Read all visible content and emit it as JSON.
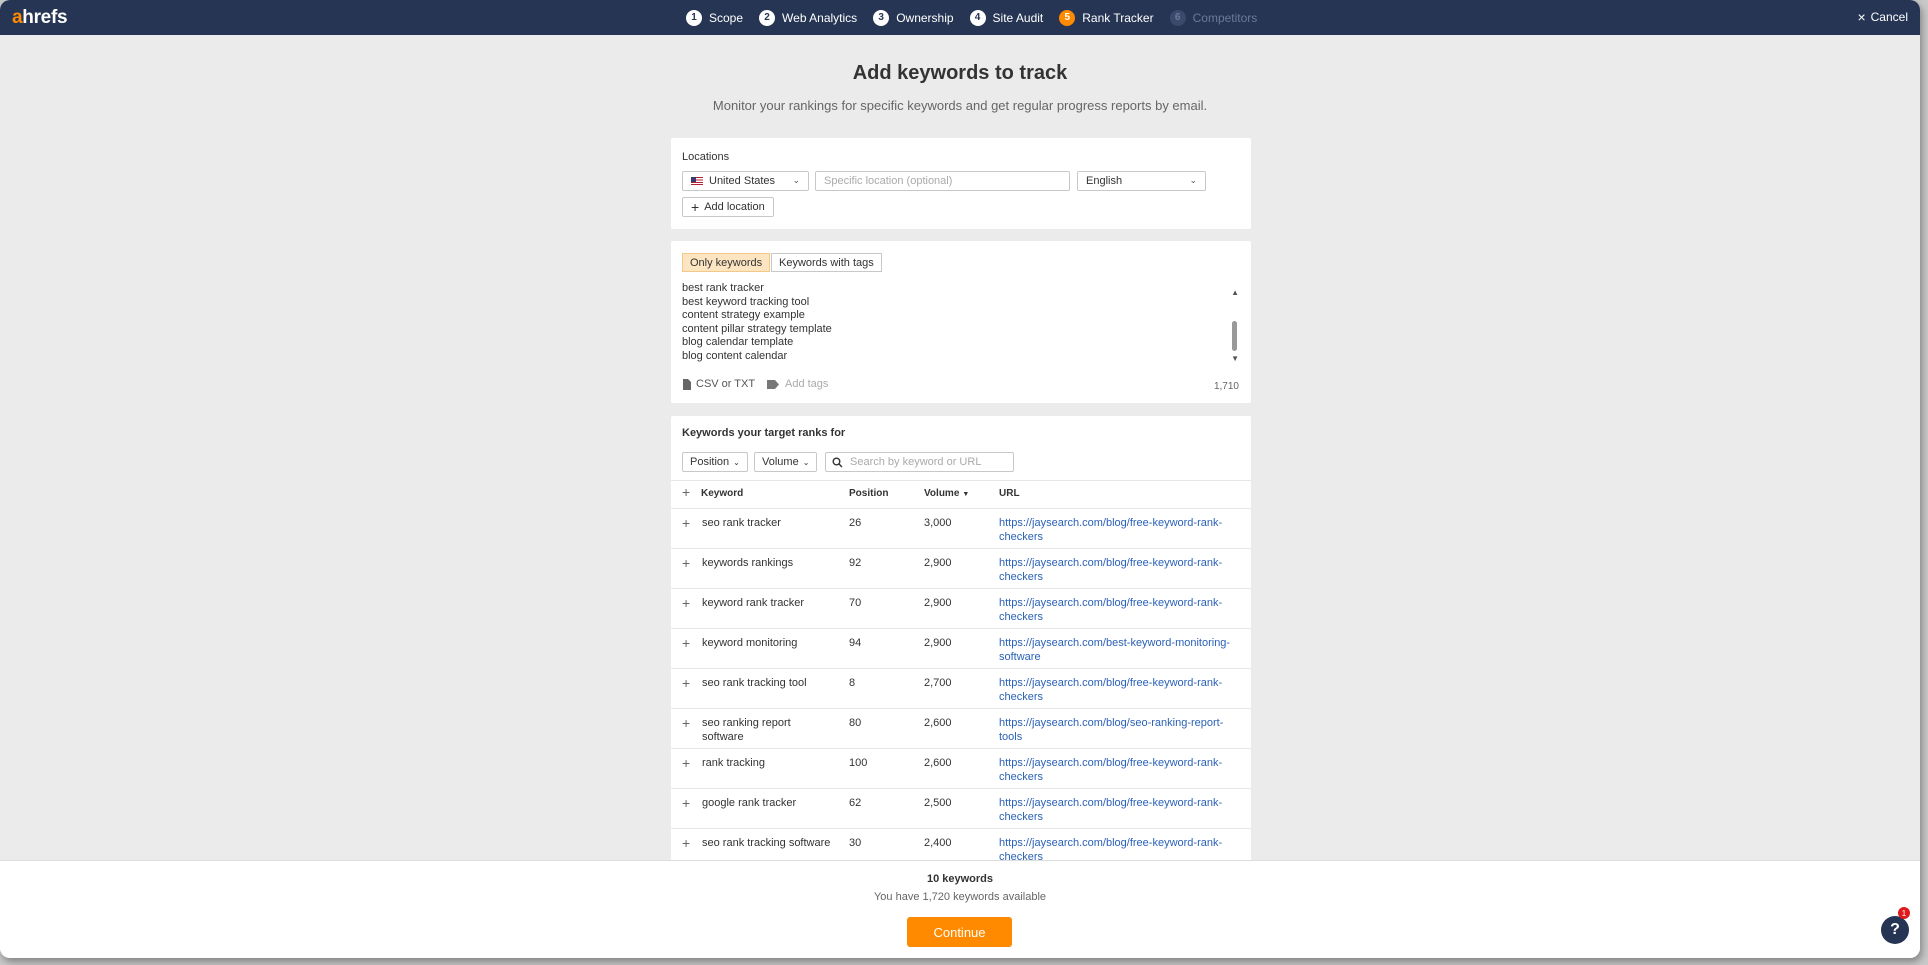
{
  "brand": {
    "logo_a": "a",
    "logo_rest": "hrefs",
    "accent": "#ff8a00",
    "nav_bg": "#263554"
  },
  "steps": [
    {
      "num": "1",
      "label": "Scope"
    },
    {
      "num": "2",
      "label": "Web Analytics"
    },
    {
      "num": "3",
      "label": "Ownership"
    },
    {
      "num": "4",
      "label": "Site Audit"
    },
    {
      "num": "5",
      "label": "Rank Tracker"
    },
    {
      "num": "6",
      "label": "Competitors"
    }
  ],
  "cancel_label": "Cancel",
  "page": {
    "title": "Add keywords to track",
    "subtitle": "Monitor your rankings for specific keywords and get regular progress reports by email."
  },
  "locations": {
    "label": "Locations",
    "country": "United States",
    "specific_placeholder": "Specific location (optional)",
    "language": "English",
    "add_location": "Add location"
  },
  "keywords_input": {
    "tabs": [
      "Only keywords",
      "Keywords with tags"
    ],
    "lines": [
      "best rank tracker",
      "best keyword tracking tool",
      "content strategy example",
      "content pillar strategy template",
      "blog calendar template",
      "blog content calendar"
    ],
    "csv_label": "CSV or TXT",
    "add_tags_label": "Add tags",
    "count": "1,710"
  },
  "target": {
    "title": "Keywords your target ranks for",
    "filters": [
      "Position",
      "Volume"
    ],
    "search_placeholder": "Search by keyword or URL",
    "headers": {
      "keyword": "Keyword",
      "position": "Position",
      "volume": "Volume",
      "url": "URL"
    },
    "rows": [
      {
        "keyword": "seo rank tracker",
        "position": "26",
        "volume": "3,000",
        "url": "https://jaysearch.com/blog/free-keyword-rank-checkers"
      },
      {
        "keyword": "keywords rankings",
        "position": "92",
        "volume": "2,900",
        "url": "https://jaysearch.com/blog/free-keyword-rank-checkers"
      },
      {
        "keyword": "keyword rank tracker",
        "position": "70",
        "volume": "2,900",
        "url": "https://jaysearch.com/blog/free-keyword-rank-checkers"
      },
      {
        "keyword": "keyword monitoring",
        "position": "94",
        "volume": "2,900",
        "url": "https://jaysearch.com/best-keyword-monitoring-software"
      },
      {
        "keyword": "seo rank tracking tool",
        "position": "8",
        "volume": "2,700",
        "url": "https://jaysearch.com/blog/free-keyword-rank-checkers"
      },
      {
        "keyword": "seo ranking report software",
        "position": "80",
        "volume": "2,600",
        "url": "https://jaysearch.com/blog/seo-ranking-report-tools"
      },
      {
        "keyword": "rank tracking",
        "position": "100",
        "volume": "2,600",
        "url": "https://jaysearch.com/blog/free-keyword-rank-checkers"
      },
      {
        "keyword": "google rank tracker",
        "position": "62",
        "volume": "2,500",
        "url": "https://jaysearch.com/blog/free-keyword-rank-checkers"
      },
      {
        "keyword": "seo rank tracking software",
        "position": "30",
        "volume": "2,400",
        "url": "https://jaysearch.com/blog/free-keyword-rank-checkers"
      }
    ]
  },
  "footer": {
    "count": "10 keywords",
    "available": "You have 1,720 keywords available",
    "continue": "Continue"
  },
  "help": {
    "label": "?",
    "badge": "1"
  }
}
